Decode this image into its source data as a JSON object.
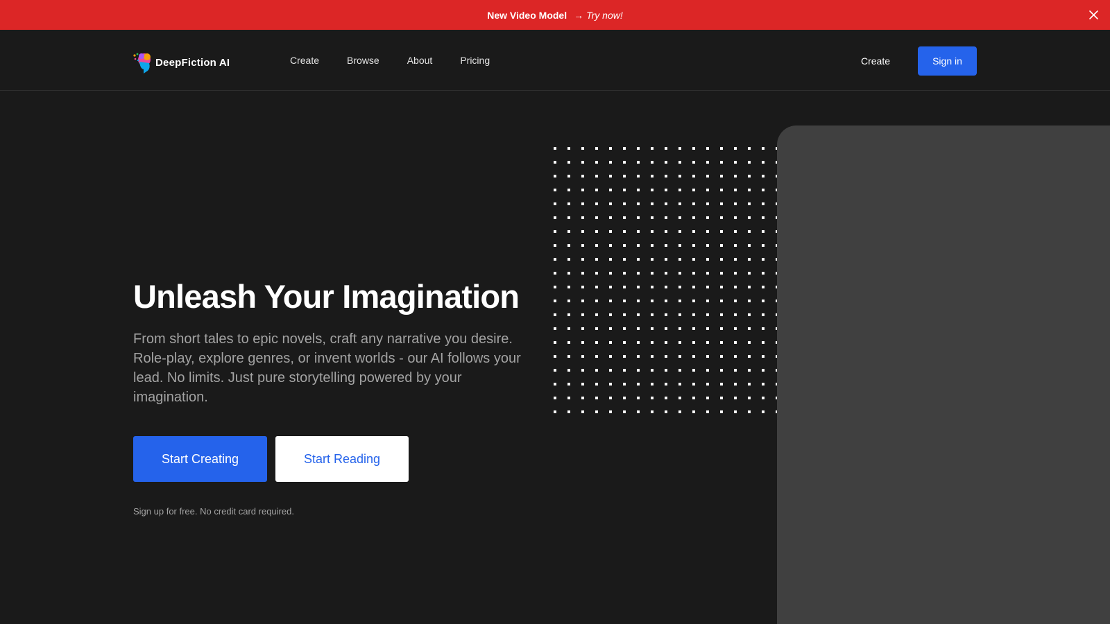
{
  "banner": {
    "title": "New Video Model",
    "arrow": "→",
    "cta": "Try now!",
    "close_icon": "close-icon",
    "color": "#dc2626"
  },
  "nav": {
    "logo_text": "DeepFiction AI",
    "links": [
      "Create",
      "Browse",
      "About",
      "Pricing"
    ],
    "right_create": "Create",
    "signin_label": "Sign in"
  },
  "hero": {
    "title": "Unleash Your Imagination",
    "subtitle": "From short tales to epic novels, craft any narrative you desire. Role-play, explore genres, or invent worlds - our AI follows your lead. No limits. Just pure storytelling powered by your imagination.",
    "primary_button": "Start Creating",
    "secondary_button": "Start Reading",
    "note": "Sign up for free. No credit card required."
  },
  "colors": {
    "accent": "#2563eb",
    "background": "#1a1a1a",
    "panel": "#404040",
    "muted_text": "#a3a3a3"
  }
}
